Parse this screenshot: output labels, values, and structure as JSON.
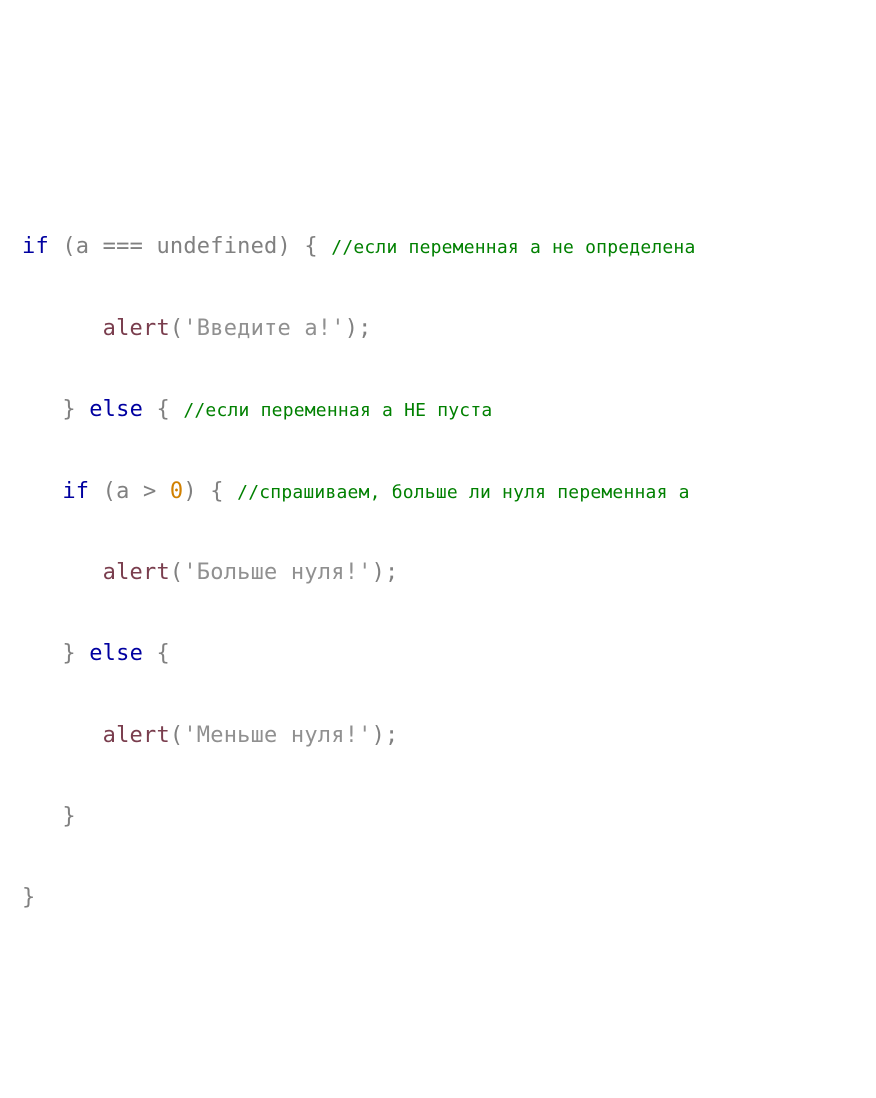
{
  "code": {
    "line1": {
      "kw_if": "if",
      "open_paren": " (",
      "var_a": "a",
      "op_eq": " === ",
      "undef": "undefined",
      "close_paren": ")",
      "open_brace": " { ",
      "comment": "//если переменная a не определена"
    },
    "line2": {
      "indent": "      ",
      "func": "alert",
      "open_paren": "(",
      "str": "'Введите a!'",
      "close_paren": ")",
      "semi": ";"
    },
    "line3": {
      "indent": "   ",
      "close_brace": "}",
      "kw_else": " else ",
      "open_brace": "{ ",
      "comment": "//если переменная a НЕ пуста"
    },
    "line4": {
      "indent": "   ",
      "kw_if": "if",
      "open_paren": " (",
      "var_a": "a",
      "op_gt": " > ",
      "zero": "0",
      "close_paren": ")",
      "open_brace": " { ",
      "comment": "//спрашиваем, больше ли нуля переменная a"
    },
    "line5": {
      "indent": "      ",
      "func": "alert",
      "open_paren": "(",
      "str": "'Больше нуля!'",
      "close_paren": ")",
      "semi": ";"
    },
    "line6": {
      "indent": "   ",
      "close_brace": "}",
      "kw_else": " else ",
      "open_brace": "{"
    },
    "line7": {
      "indent": "      ",
      "func": "alert",
      "open_paren": "(",
      "str": "'Меньше нуля!'",
      "close_paren": ")",
      "semi": ";"
    },
    "line8": {
      "indent": "   ",
      "close_brace": "}"
    },
    "line9": {
      "close_brace": "}"
    }
  }
}
